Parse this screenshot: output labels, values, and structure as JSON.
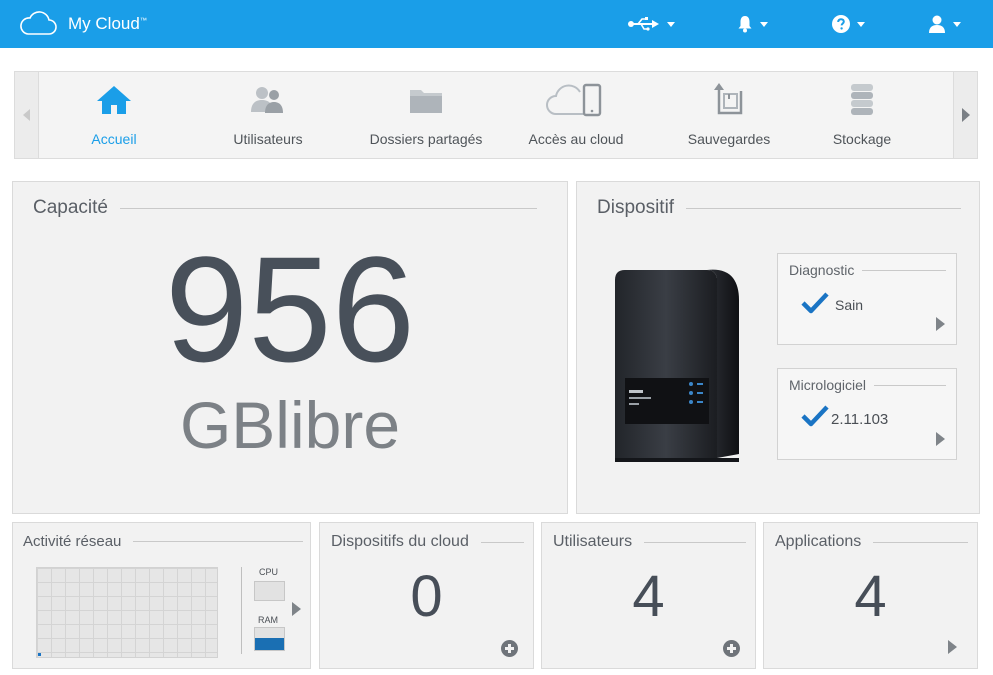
{
  "app": {
    "title": "My Cloud",
    "trademark": "™"
  },
  "topbar": {
    "icons": [
      "usb-icon",
      "bell-icon",
      "help-icon",
      "user-icon"
    ],
    "accent": "#1a9ee8"
  },
  "nav": {
    "items": [
      {
        "label": "Accueil",
        "icon": "home-icon",
        "active": true
      },
      {
        "label": "Utilisateurs",
        "icon": "users-icon",
        "active": false
      },
      {
        "label": "Dossiers partagés",
        "icon": "folder-icon",
        "active": false
      },
      {
        "label": "Accès au cloud",
        "icon": "cloud-device-icon",
        "active": false
      },
      {
        "label": "Sauvegardes",
        "icon": "backup-icon",
        "active": false
      },
      {
        "label": "Stockage",
        "icon": "storage-icon",
        "active": false
      }
    ]
  },
  "capacity": {
    "title": "Capacité",
    "value": "956",
    "unit": "GBlibre"
  },
  "device": {
    "title": "Dispositif",
    "diagnostic": {
      "title": "Diagnostic",
      "status": "Sain"
    },
    "firmware": {
      "title": "Micrologiciel",
      "version": "2.11.103"
    }
  },
  "cards": {
    "network": {
      "title": "Activité réseau",
      "cpu_label": "CPU",
      "ram_label": "RAM"
    },
    "cloud_devices": {
      "title": "Dispositifs du cloud",
      "count": "0"
    },
    "users": {
      "title": "Utilisateurs",
      "count": "4"
    },
    "apps": {
      "title": "Applications",
      "count": "4"
    }
  }
}
